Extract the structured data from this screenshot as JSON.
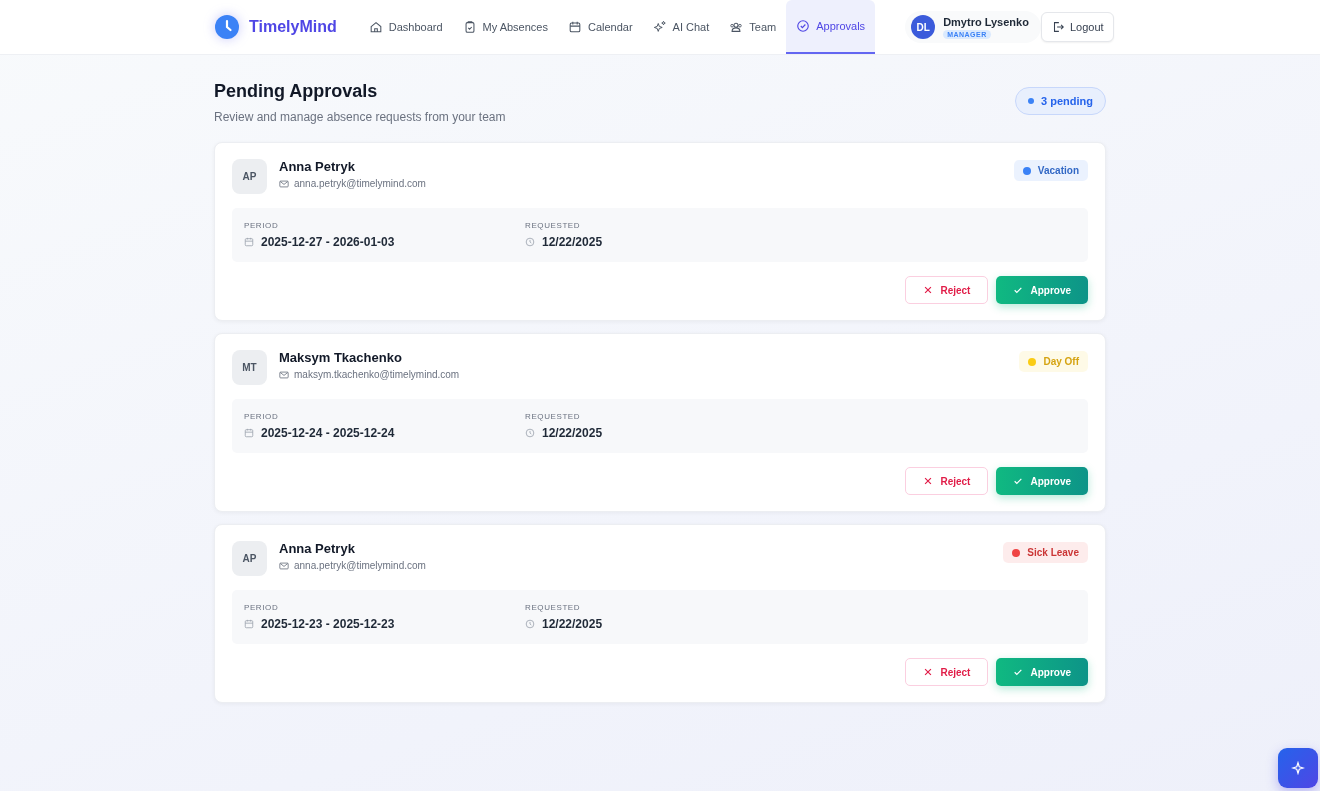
{
  "brand": {
    "name": "TimelyMind"
  },
  "nav": [
    {
      "label": "Dashboard",
      "kind": "home",
      "selected": false
    },
    {
      "label": "My Absences",
      "kind": "clipboard",
      "selected": false
    },
    {
      "label": "Calendar",
      "kind": "calendar",
      "selected": false
    },
    {
      "label": "AI Chat",
      "kind": "sparkle",
      "selected": false
    },
    {
      "label": "Team",
      "kind": "team",
      "selected": false
    },
    {
      "label": "Approvals",
      "kind": "check",
      "selected": true
    }
  ],
  "user": {
    "initials": "DL",
    "name": "Dmytro Lysenko",
    "role": "MANAGER"
  },
  "logout": "Logout",
  "page": {
    "title": "Pending Approvals",
    "subtitle": "Review and manage absence requests from your team",
    "count": "3 pending"
  },
  "requests": [
    {
      "initials": "AP",
      "name": "Anna Petryk",
      "email": "anna.petryk@timelymind.com",
      "type": "Vacation",
      "color": "#3b82f6",
      "period_label": "PERIOD",
      "period": "2025-12-27 - 2026-01-03",
      "requested_label": "REQUESTED",
      "requested": "12/22/2025",
      "reject": "Reject",
      "approve": "Approve"
    },
    {
      "initials": "MT",
      "name": "Maksym Tkachenko",
      "email": "maksym.tkachenko@timelymind.com",
      "type": "Day Off",
      "color": "#facc15",
      "period_label": "PERIOD",
      "period": "2025-12-24 - 2025-12-24",
      "requested_label": "REQUESTED",
      "requested": "12/22/2025",
      "reject": "Reject",
      "approve": "Approve"
    },
    {
      "initials": "AP",
      "name": "Anna Petryk",
      "email": "anna.petryk@timelymind.com",
      "type": "Sick Leave",
      "color": "#ef4444",
      "period_label": "PERIOD",
      "period": "2025-12-23 - 2025-12-23",
      "requested_label": "REQUESTED",
      "requested": "12/22/2025",
      "reject": "Reject",
      "approve": "Approve"
    }
  ]
}
